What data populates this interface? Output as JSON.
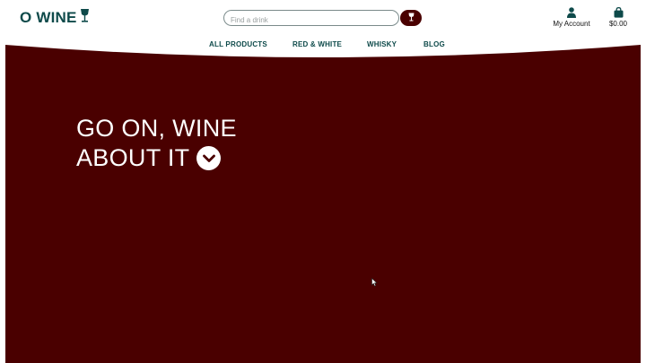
{
  "brand": {
    "name": "O WINE",
    "logo_icon": "wine-glass-icon"
  },
  "search": {
    "placeholder": "Find a drink",
    "button_icon": "wine-glass-icon"
  },
  "account": {
    "label": "My Account",
    "icon": "user-icon"
  },
  "cart": {
    "total": "$0.00",
    "icon": "shopping-bag-icon"
  },
  "nav": {
    "items": [
      {
        "label": "ALL PRODUCTS"
      },
      {
        "label": "RED & WHITE"
      },
      {
        "label": "WHISKY"
      },
      {
        "label": "BLOG"
      }
    ]
  },
  "hero": {
    "line1": "GO ON, WINE",
    "line2": "ABOUT IT",
    "scroll_icon": "chevron-down-circle-icon"
  },
  "colors": {
    "brand_teal": "#0e4a4a",
    "hero_bg": "#4a0000",
    "text_dark": "#111111"
  }
}
